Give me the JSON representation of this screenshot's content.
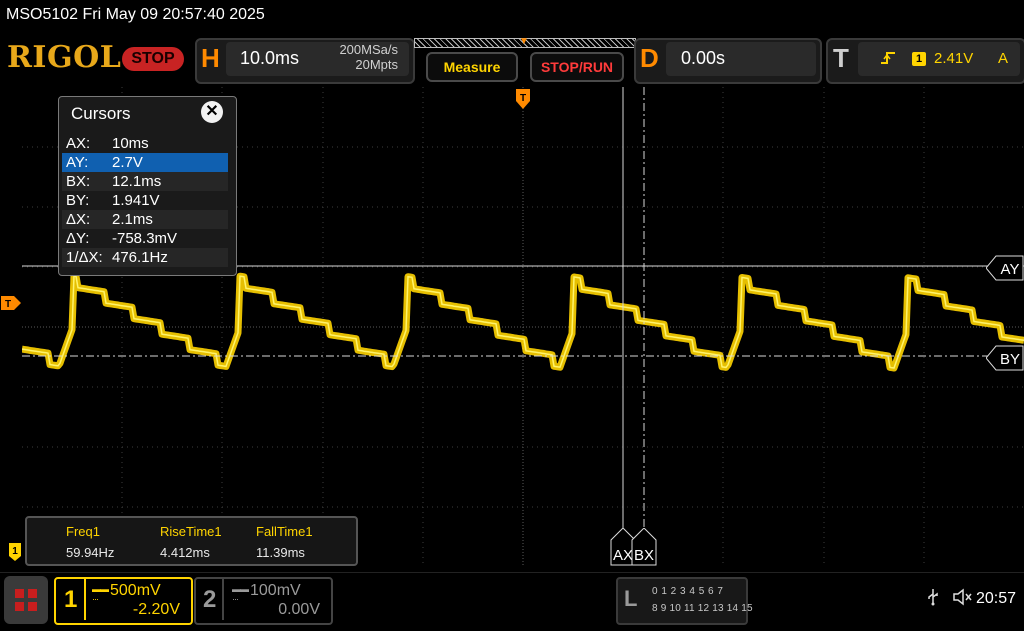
{
  "title_bar": {
    "text": "MSO5102  Fri May 09 20:57:40 2025"
  },
  "header": {
    "logo": "RIGOL",
    "run_status": "STOP",
    "horizontal": {
      "letter": "H",
      "timebase": "10.0ms",
      "sample_rate": "200MSa/s",
      "memory_depth": "20Mpts"
    },
    "menu_measure": "Measure",
    "menu_stoprun": "STOP/RUN",
    "delay": {
      "letter": "D",
      "value": "0.00s"
    },
    "trigger": {
      "letter": "T",
      "edge_icon": "rising-edge-icon",
      "source": "1",
      "level": "2.41V",
      "mode": "A"
    }
  },
  "waveform": {
    "channel_color": "#ffd400",
    "trigger_marker": "T",
    "channel_marker": "1"
  },
  "cursors_panel": {
    "title": "Cursors",
    "close_glyph": "✕",
    "rows": [
      {
        "key": "AX:",
        "value": "10ms"
      },
      {
        "key": "AY:",
        "value": "2.7V"
      },
      {
        "key": "BX:",
        "value": "12.1ms"
      },
      {
        "key": "BY:",
        "value": "1.941V"
      },
      {
        "key": "ΔX:",
        "value": "2.1ms"
      },
      {
        "key": "ΔY:",
        "value": "-758.3mV"
      },
      {
        "key": "1/ΔX:",
        "value": "476.1Hz"
      }
    ],
    "selected_row": 1
  },
  "cursor_labels": {
    "ay": "AY",
    "by": "BY",
    "ax": "AX",
    "bx": "BX"
  },
  "measurements": [
    {
      "label": "Freq1",
      "value": "59.94Hz"
    },
    {
      "label": "RiseTime1",
      "value": "4.412ms"
    },
    {
      "label": "FallTime1",
      "value": "11.39ms"
    }
  ],
  "bottom_bar": {
    "ch1": {
      "number": "1",
      "scale": "500mV",
      "offset": "-2.20V"
    },
    "ch2": {
      "number": "2",
      "scale": "100mV",
      "offset": "0.00V"
    },
    "logic": {
      "letter": "L",
      "row1": "0 1 2 3  4 5 6 7",
      "row2": "8 9 10 11 12 13 14 15"
    },
    "clock": "20:57"
  }
}
